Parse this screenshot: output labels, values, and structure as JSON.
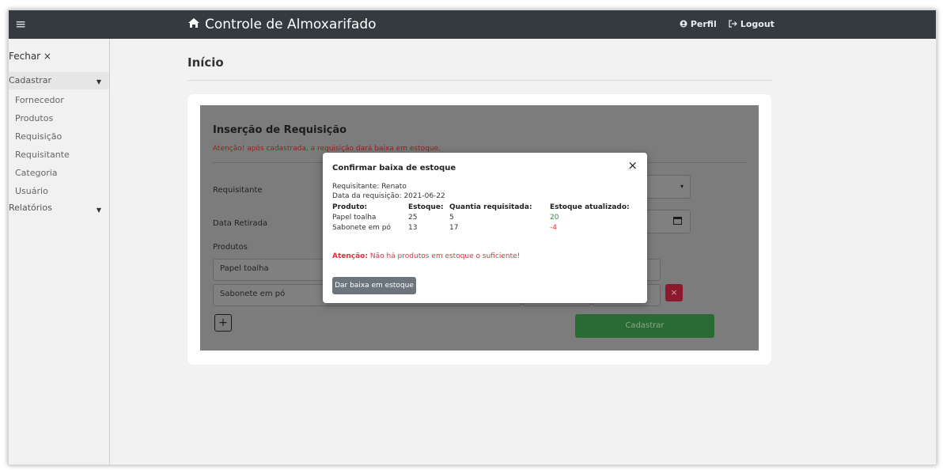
{
  "navbar": {
    "menu_icon": "hamburger-icon",
    "home_icon": "home-icon",
    "brand": "Controle de Almoxarifado",
    "perfil": "Perfil",
    "perfil_icon": "user-circle-icon",
    "logout": "Logout",
    "logout_icon": "sign-out-icon"
  },
  "sidebar": {
    "close": "Fechar ×",
    "cadastrar": "Cadastrar",
    "items": [
      "Fornecedor",
      "Produtos",
      "Requisição",
      "Requisitante",
      "Categoria",
      "Usuário"
    ],
    "relatorios": "Relatórios"
  },
  "main": {
    "title": "Início"
  },
  "form": {
    "title": "Inserção de Requisição",
    "warning": "Atenção! após cadastrada, a requisição dará baixa em estoque.",
    "requisitante_label": "Requisitante",
    "data_label": "Data Retirada",
    "produtos_label": "Produtos",
    "produto_1": "Papel toalha",
    "produto_2": "Sabonete em pó",
    "add_button": "+",
    "remove_button": "×",
    "submit_button": "Cadastrar"
  },
  "modal": {
    "title": "Confirmar baixa de estoque",
    "close": "×",
    "requisitante": "Requisitante: Renato",
    "data": "Data da requisição: 2021-06-22",
    "headers": [
      "Produto:",
      "Estoque:",
      "Quantia requisitada:",
      "Estoque atualizado:"
    ],
    "rows": [
      {
        "produto": "Papel toalha",
        "estoque": "25",
        "quantia": "5",
        "atualizado": "20"
      },
      {
        "produto": "Sabonete em pó",
        "estoque": "13",
        "quantia": "17",
        "atualizado": "-4"
      }
    ],
    "attention_label": "Atenção:",
    "attention_text": "Não há produtos em estoque o suficiente!",
    "button": "Dar baixa em estoque"
  },
  "colors": {
    "navbar": "#343a40",
    "danger": "#dc3545",
    "success": "#28a745",
    "secondary": "#6c757d"
  }
}
